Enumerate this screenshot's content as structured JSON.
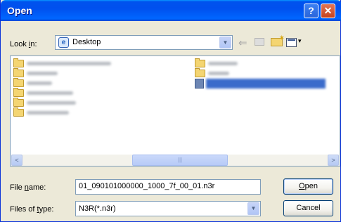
{
  "window": {
    "title": "Open",
    "help_glyph": "?",
    "close_glyph": "✕"
  },
  "lookin": {
    "label_pre": "Look ",
    "label_key": "i",
    "label_post": "n:",
    "value": "Desktop"
  },
  "toolbar": [
    "back-icon",
    "up-folder-icon",
    "new-folder-icon",
    "view-menu-icon"
  ],
  "files": {
    "left_col": [
      "folder",
      "folder",
      "folder",
      "folder",
      "folder",
      "folder"
    ],
    "right_col": [
      "folder",
      "folder",
      "file-selected"
    ]
  },
  "scrollbar": {
    "left_arrow": "<",
    "right_arrow": ">",
    "thumb_grip": "|||"
  },
  "filename": {
    "label_pre": "File ",
    "label_key": "n",
    "label_post": "ame:",
    "value": "01_090101000000_1000_7f_00_01.n3r"
  },
  "filetype": {
    "label_pre": "Files of ",
    "label_key": "t",
    "label_post": "ype:",
    "value": "N3R(*.n3r)"
  },
  "buttons": {
    "open_key": "O",
    "open_rest": "pen",
    "cancel": "Cancel"
  }
}
